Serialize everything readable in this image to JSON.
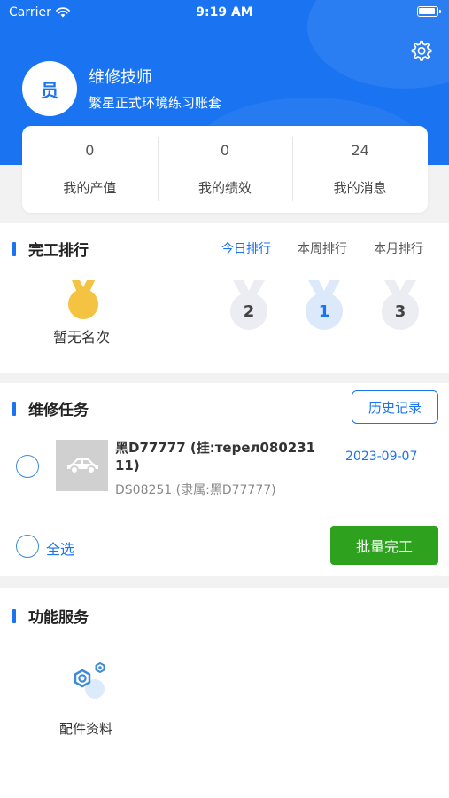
{
  "status_bar": {
    "carrier": "Carrier",
    "time": "9:19 AM"
  },
  "profile": {
    "avatar_char": "员",
    "name": "维修技师",
    "account": "繁星正式环境练习账套"
  },
  "stats": [
    {
      "value": "0",
      "label": "我的产值"
    },
    {
      "value": "0",
      "label": "我的绩效"
    },
    {
      "value": "24",
      "label": "我的消息"
    }
  ],
  "ranking": {
    "title": "完工排行",
    "tabs": [
      "今日排行",
      "本周排行",
      "本月排行"
    ],
    "active_tab": "今日排行",
    "no_rank_text": "暂无名次",
    "podium": [
      "2",
      "1",
      "3"
    ]
  },
  "tasks": {
    "title": "维修任务",
    "history_label": "历史记录",
    "items": [
      {
        "title": "黑D77777 (挂:терел080231 11)",
        "subtitle": "DS08251 (隶属:黑D77777)",
        "date": "2023-09-07"
      }
    ],
    "select_all_label": "全选",
    "batch_complete_label": "批量完工"
  },
  "services": {
    "title": "功能服务",
    "items": [
      {
        "label": "配件资料",
        "icon": "parts-icon"
      }
    ]
  },
  "colors": {
    "primary": "#1a73f0",
    "success": "#2ea11e",
    "medal_gold": "#f5c342",
    "silver": "#ebedf2",
    "blue_light": "#dbe9fb"
  }
}
